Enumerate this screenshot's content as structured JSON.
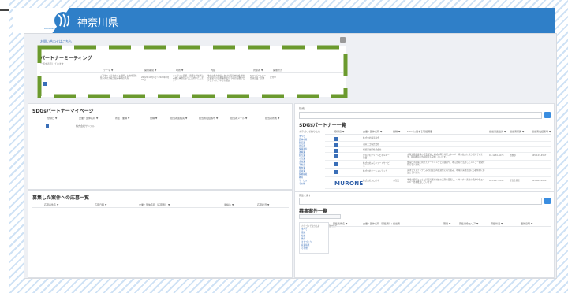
{
  "header": {
    "site_title": "神奈川県",
    "org_mark": "KANAGAWA",
    "brand_color": "#2f7fc8"
  },
  "notice": {
    "link": "お問い合わせはこちら"
  },
  "meeting": {
    "title": "パートナーミーティング",
    "sub": "一覧を表示しています",
    "columns": [
      "テーマ ▼",
      "開催期間 ▼",
      "場所 ▼",
      "内容",
      "対象者 ▼",
      "開催状況"
    ],
    "row": {
      "theme": "ご当地キャラクターと連携した地域活性化へ向けた取り組み事例の共有",
      "period": "2022年10月1日〜2023年3月31日",
      "place": "オンライン開催（詳細は参加申込み後に事務局よりご案内いたします）",
      "content": "地域の魅力発信に向けた意見交換会 参加企業間での連携事例紹介 今後の協働プロジェクトについての検討",
      "target": "SDGsパートナー登録企業・団体",
      "status": "受付中"
    }
  },
  "mypage": {
    "title": "SDGsパートナーマイページ",
    "columns": [
      "登録日 ▼",
      "企業・団体名称 ▼",
      "所在・業種 ▼",
      "業種 ▼",
      "担当者連絡先 ▼",
      "担当者電話番号 ▼",
      "担当者メール ▼",
      "担当者所属 ▼"
    ],
    "row_name": "株式会社サンプル"
  },
  "applications": {
    "title": "募集した案件への応募一覧",
    "columns": [
      "応募案件名 ▼",
      "応募日時 ▼",
      "企業・団体名称（応募者） ▼",
      "連絡先 ▼",
      "応募状況 ▼"
    ]
  },
  "partner_list": {
    "search_label": "検索",
    "search_placeholder": "キーワード",
    "title": "SDGsパートナー一覧",
    "filter_label": "カテゴリで絞り込む",
    "categories": [
      "すべて",
      "農林水産",
      "製造業",
      "建設業",
      "情報通信",
      "運輸業",
      "卸売業",
      "小売業",
      "金融業",
      "不動産",
      "飲食業",
      "宿泊業",
      "医療福祉",
      "教育",
      "サービス",
      "その他"
    ],
    "columns": [
      "登録日 ▼",
      "企業・団体名称 ▼",
      "業種 ▼",
      "SDGsに関する取組概要",
      "担当者連絡先 ▼",
      "担当者所属 ▼",
      "担当者電話番号 ▼"
    ],
    "rows": [
      {
        "name": "株式会社横浜商会",
        "desc": "",
        "c1": "",
        "c2": "",
        "c3": ""
      },
      {
        "name": "湘南エコ株式会社",
        "desc": "",
        "c1": "",
        "c2": "",
        "c3": ""
      },
      {
        "name": "相模原技研株式会社",
        "desc": "",
        "c1": "",
        "c2": "",
        "c3": ""
      },
      {
        "name": "かながわグリーンエネルギー協会",
        "desc": "太陽光発電設備の普及促進と地域の再生可能エネルギー導入拡大に取り組んでいます。環境教育の出前授業も実施しています。",
        "c1": "03-1234-5678",
        "c2": "総務部",
        "c3": "045-123-4567"
      },
      {
        "name": "株式会社みらいフードサービス",
        "desc": "食品ロス削減に向けたフードバンクとの連携や、地元食材を活用したメニュー開発を行っています。",
        "c1": "",
        "c2": "",
        "c3": ""
      },
      {
        "name": "株式会社オーシャンテック",
        "desc": "海洋プラスチックごみの回収と再資源化に取り組み、地域の清掃活動にも積極的に参加しています。",
        "c1": "",
        "c2": "",
        "c3": ""
      },
      {
        "name": "株式会社ムロオネ",
        "logo": "MURONE",
        "industry": "小売業",
        "desc": "地域の皆様とともに持続可能な社会の実現を目指し、リサイクル素材の活用や省エネルギー化を推進しています。",
        "c1": "045-987-6543",
        "c2": "経営企画室",
        "c3": "045-987-6500"
      }
    ]
  },
  "second_search": {
    "label": "募集を探す",
    "placeholder": "キーワード"
  },
  "recruit_list": {
    "title": "募集案件一覧",
    "button": "募集案件を登録する（企業・団体向け）",
    "filter_label": "カテゴリで絞り込む",
    "categories": [
      "すべて",
      "環境",
      "福祉",
      "教育",
      "まちづくり",
      "産業振興",
      "その他"
    ],
    "columns": [
      "募集案件名 ▼",
      "企業・団体名称（募集者）/ 担当者",
      "期間 ▼",
      "募集対象エリア ▼",
      "募集状況 ▼",
      "更新日時 ▼"
    ]
  }
}
